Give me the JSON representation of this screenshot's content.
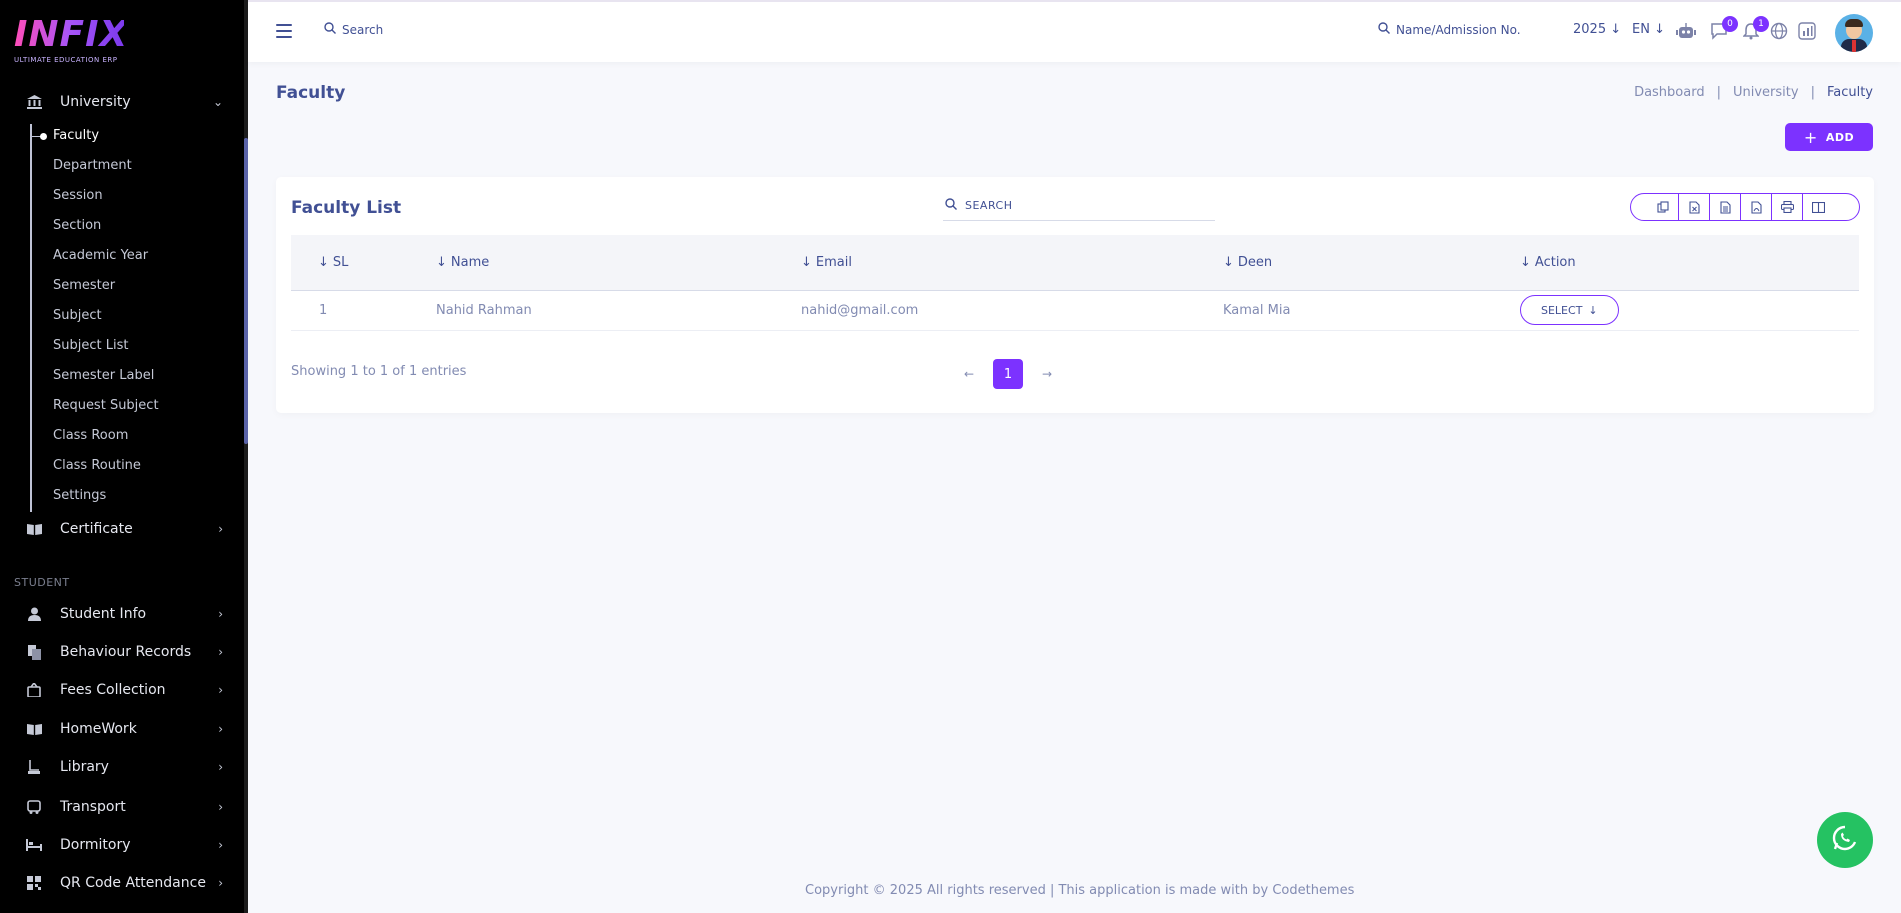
{
  "brand": {
    "logo_text": "INFIX",
    "tagline": "ULTIMATE EDUCATION ERP"
  },
  "sidebar": {
    "university": {
      "label": "University",
      "icon": "university-icon"
    },
    "university_items": [
      {
        "label": "Faculty",
        "active": true
      },
      {
        "label": "Department"
      },
      {
        "label": "Session"
      },
      {
        "label": "Section"
      },
      {
        "label": "Academic Year"
      },
      {
        "label": "Semester"
      },
      {
        "label": "Subject"
      },
      {
        "label": "Subject List"
      },
      {
        "label": "Semester Label"
      },
      {
        "label": "Request Subject"
      },
      {
        "label": "Class Room"
      },
      {
        "label": "Class Routine"
      },
      {
        "label": "Settings"
      }
    ],
    "certificate": {
      "label": "Certificate",
      "icon": "book-icon"
    },
    "section_label": "STUDENT",
    "student_menu": [
      {
        "label": "Student Info",
        "icon": "user-icon"
      },
      {
        "label": "Behaviour Records",
        "icon": "records-icon"
      },
      {
        "label": "Fees Collection",
        "icon": "fees-icon"
      },
      {
        "label": "HomeWork",
        "icon": "book-icon"
      },
      {
        "label": "Library",
        "icon": "library-icon"
      },
      {
        "label": "Transport",
        "icon": "bus-icon"
      },
      {
        "label": "Dormitory",
        "icon": "bed-icon"
      },
      {
        "label": "QR Code Attendance",
        "icon": "qr-icon"
      }
    ]
  },
  "topbar": {
    "search_label": "Search",
    "student_search_label": "Name/Admission No.",
    "year": "2025",
    "language": "EN",
    "chat_badge": "0",
    "notification_badge": "1"
  },
  "page": {
    "title": "Faculty",
    "breadcrumb": [
      "Dashboard",
      "University",
      "Faculty"
    ],
    "add_label": "ADD"
  },
  "card": {
    "title": "Faculty List",
    "search_placeholder": "SEARCH",
    "columns": [
      "SL",
      "Name",
      "Email",
      "Deen",
      "Action"
    ],
    "rows": [
      {
        "sl": "1",
        "name": "Nahid Rahman",
        "email": "nahid@gmail.com",
        "deen": "Kamal Mia",
        "action": "SELECT"
      }
    ],
    "showing": "Showing 1 to 1 of 1 entries",
    "current_page": "1"
  },
  "footer": "Copyright © 2025 All rights reserved | This application is made with by Codethemes",
  "colors": {
    "accent": "#7c32ff",
    "text": "#415094",
    "muted": "#828bb2",
    "whatsapp": "#25c262"
  }
}
